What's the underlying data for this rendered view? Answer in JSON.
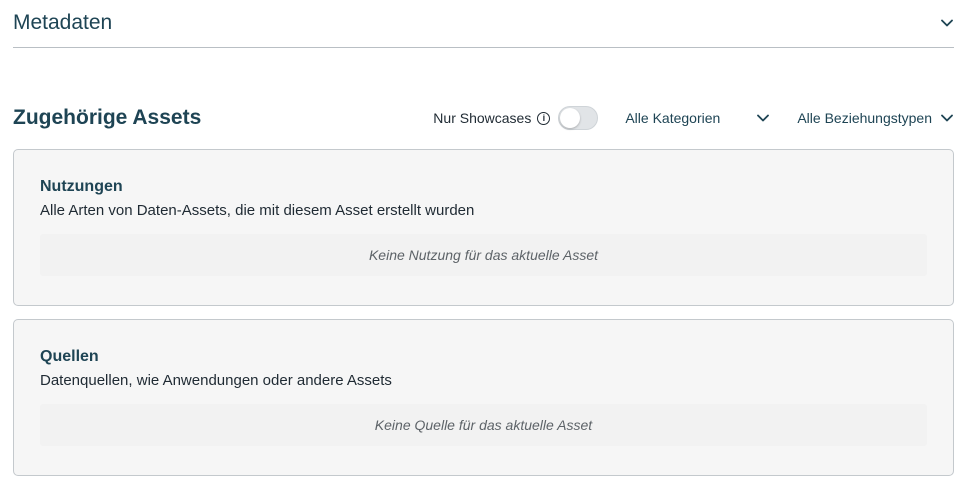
{
  "metadaten": {
    "title": "Metadaten",
    "chevron_icon": "chevron-down-icon"
  },
  "assets": {
    "title": "Zugehörige Assets",
    "filters": {
      "showcases_label": "Nur Showcases",
      "info_icon": "info-icon",
      "info_glyph": "i",
      "kategorien_label": "Alle Kategorien",
      "beziehungstypen_label": "Alle Beziehungstypen"
    }
  },
  "cards": {
    "nutzungen": {
      "title": "Nutzungen",
      "description": "Alle Arten von Daten-Assets, die mit diesem Asset erstellt wurden",
      "empty": "Keine Nutzung für das aktuelle Asset"
    },
    "quellen": {
      "title": "Quellen",
      "description": "Datenquellen, wie Anwendungen oder andere Assets",
      "empty": "Keine Quelle für das aktuelle Asset"
    }
  },
  "colors": {
    "accent": "#1e4454",
    "card_bg": "#f6f6f6",
    "border": "#c4c9cd"
  }
}
